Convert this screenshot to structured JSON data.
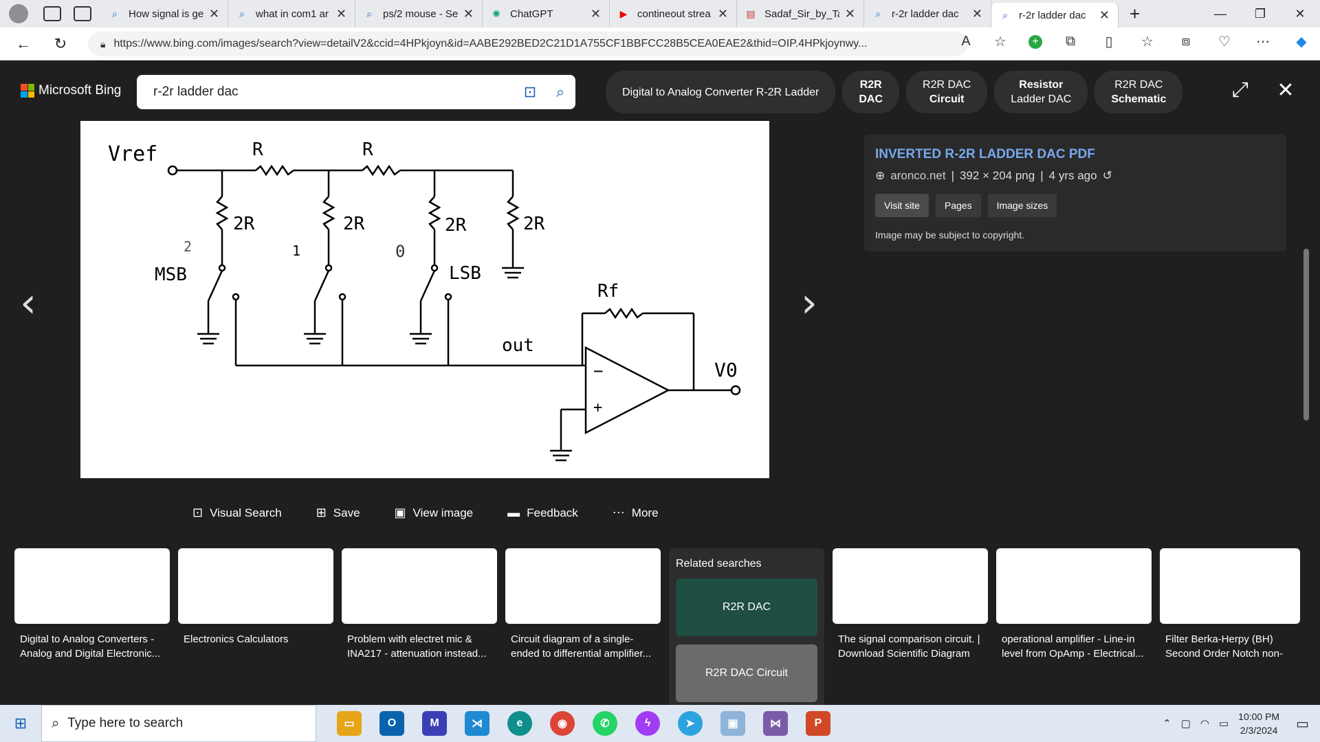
{
  "browser": {
    "tabs": [
      {
        "icon": "search-icon",
        "title": "How signal is ge"
      },
      {
        "icon": "search-icon",
        "title": "what in com1 ar"
      },
      {
        "icon": "search-icon",
        "title": "ps/2 mouse - Se"
      },
      {
        "icon": "chatgpt-icon",
        "title": "ChatGPT"
      },
      {
        "icon": "youtube-icon",
        "title": "contineout strea"
      },
      {
        "icon": "pdf-icon",
        "title": "Sadaf_Sir_by_Ta"
      },
      {
        "icon": "search-icon",
        "title": "r-2r ladder dac"
      },
      {
        "icon": "search-icon",
        "title": "r-2r ladder dac"
      }
    ],
    "url": "https://www.bing.com/images/search?view=detailV2&ccid=4HPkjoyn&id=AABE292BED2C21D1A755CF1BBFCC28B5CEA0EAE2&thid=OIP.4HPkjoynwy..."
  },
  "bing": {
    "logo_text": "Microsoft Bing",
    "query": "r-2r ladder dac",
    "related_pills": [
      {
        "line1": "Digital to Analog Converter R-2R Ladder",
        "line2": "",
        "bold": ""
      },
      {
        "line1": "R2R",
        "line2": "DAC",
        "bold": "all"
      },
      {
        "line1": "R2R DAC",
        "line2": "Circuit",
        "bold": "line2"
      },
      {
        "line1": "Resistor",
        "line2": "Ladder DAC",
        "bold": "line1"
      },
      {
        "line1": "R2R DAC",
        "line2": "Schematic",
        "bold": "line2"
      }
    ]
  },
  "viewer": {
    "info": {
      "title": "INVERTED R-2R LADDER DAC PDF",
      "site": "aronco.net",
      "dimensions": "392 × 204 png",
      "age": "4 yrs ago",
      "buttons": [
        "Visit site",
        "Pages",
        "Image sizes"
      ],
      "copyright": "Image may be subject to copyright."
    },
    "actions": [
      "Visual Search",
      "Save",
      "View image",
      "Feedback",
      "More"
    ],
    "circuit": {
      "vref": "Vref",
      "r_label": "R",
      "two_r": "2R",
      "msb": "MSB",
      "lsb": "LSB",
      "bit_marks": [
        "2",
        "1",
        "0"
      ],
      "rf": "Rf",
      "iout": "out",
      "vo": "V0",
      "minus": "−",
      "plus": "+"
    },
    "thumbnails": [
      {
        "caption": "Digital to Analog Converters - Analog and Digital Electronic..."
      },
      {
        "caption": "Electronics Calculators"
      },
      {
        "caption": "Problem with electret mic & INA217 - attenuation instead..."
      },
      {
        "caption": "Circuit diagram of a single-ended to differential amplifier..."
      },
      {
        "caption": "The signal comparison circuit. | Download Scientific Diagram"
      },
      {
        "caption": "operational amplifier - Line-in level from OpAmp - Electrical..."
      },
      {
        "caption": "Filter Berka-Herpy (BH) Second Order Notch non-inverting -..."
      }
    ],
    "related_searches": {
      "title": "Related searches",
      "items": [
        "R2R DAC",
        "R2R DAC Circuit"
      ]
    }
  },
  "taskbar": {
    "search_placeholder": "Type here to search",
    "time": "10:00 PM",
    "date": "2/3/2024"
  }
}
